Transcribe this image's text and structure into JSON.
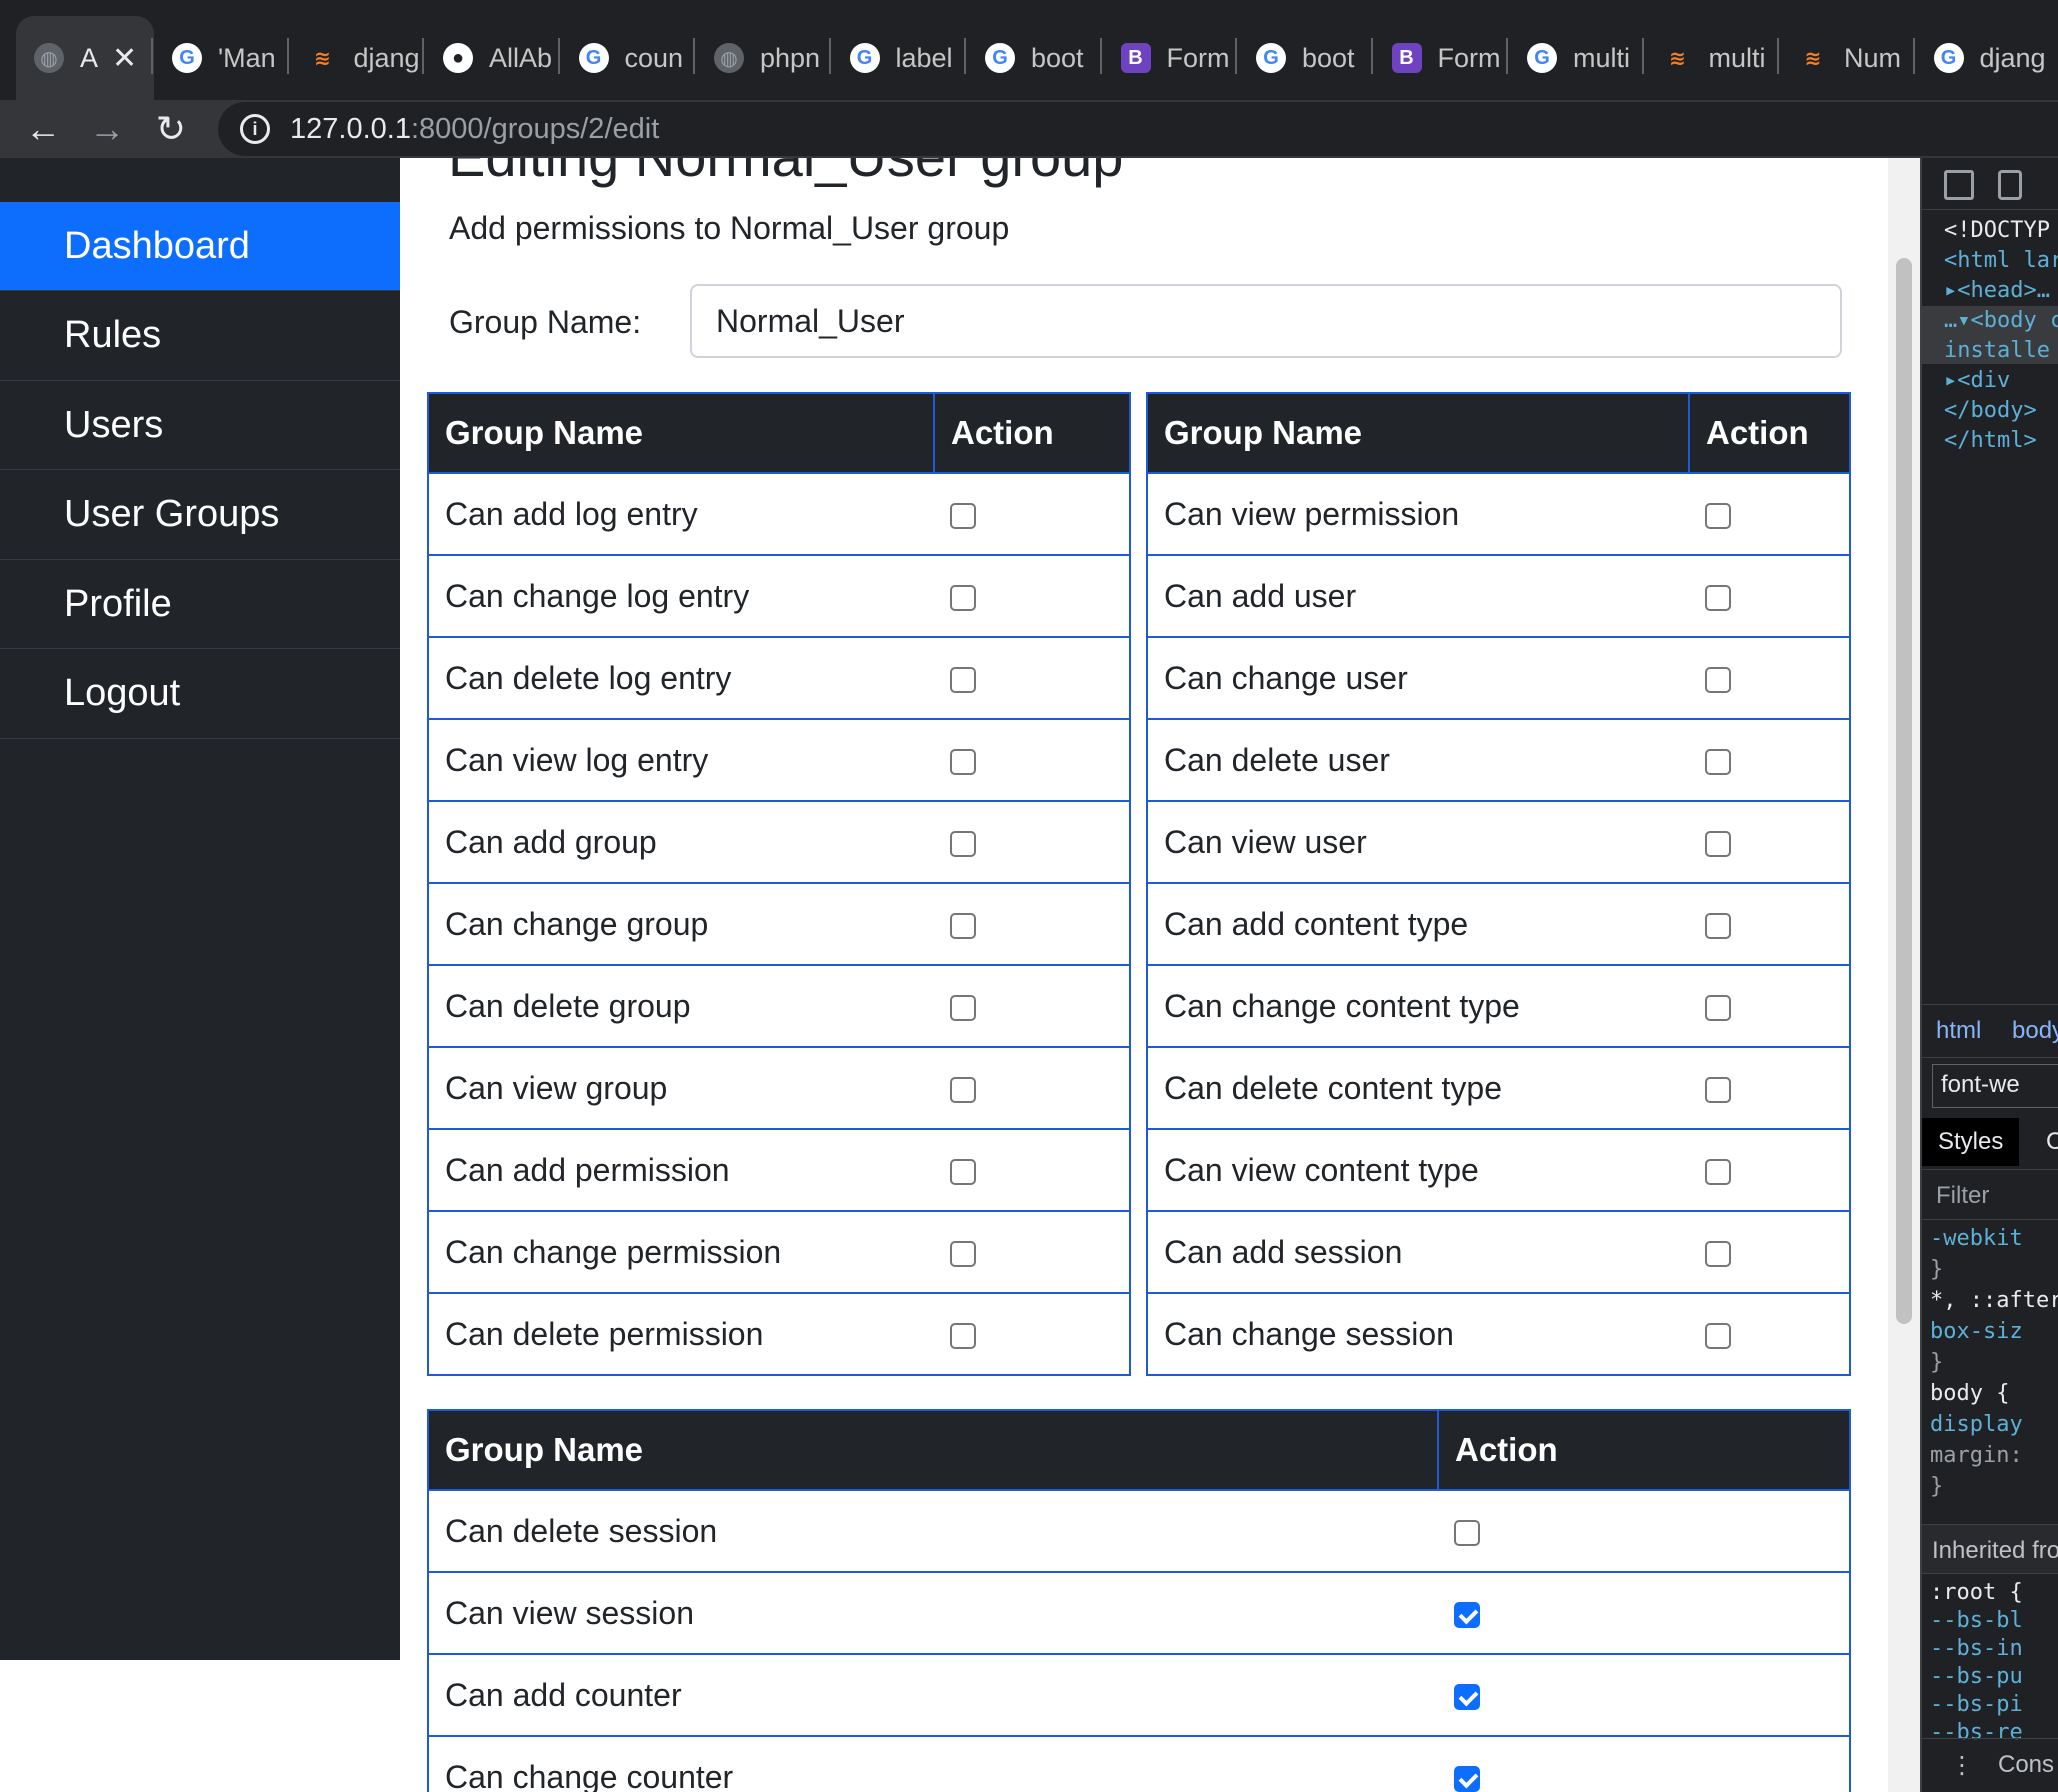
{
  "browser": {
    "tabs": [
      {
        "title": "A",
        "icon": "globe-icon",
        "active": true
      },
      {
        "title": "'Man",
        "icon": "google-icon"
      },
      {
        "title": "djang",
        "icon": "stackoverflow-icon"
      },
      {
        "title": "AllAb",
        "icon": "github-icon"
      },
      {
        "title": "coun",
        "icon": "google-icon"
      },
      {
        "title": "phpn",
        "icon": "globe-icon"
      },
      {
        "title": "label",
        "icon": "google-icon"
      },
      {
        "title": "boot",
        "icon": "google-icon"
      },
      {
        "title": "Form",
        "icon": "bootstrap-icon"
      },
      {
        "title": "boot",
        "icon": "google-icon"
      },
      {
        "title": "Form",
        "icon": "bootstrap-icon"
      },
      {
        "title": "multi",
        "icon": "google-icon"
      },
      {
        "title": "multi",
        "icon": "stackoverflow-icon"
      },
      {
        "title": "Num",
        "icon": "stackoverflow-icon"
      },
      {
        "title": "djang",
        "icon": "google-icon"
      }
    ],
    "close_glyph": "✕",
    "url_host": "127.0.0.1",
    "url_path": ":8000/groups/2/edit",
    "back_glyph": "←",
    "forward_glyph": "→",
    "reload_glyph": "↻"
  },
  "sidebar": {
    "items": [
      {
        "label": "Dashboard",
        "active": true
      },
      {
        "label": "Rules"
      },
      {
        "label": "Users"
      },
      {
        "label": "User Groups"
      },
      {
        "label": "Profile"
      },
      {
        "label": "Logout"
      }
    ]
  },
  "main": {
    "title": "Editing Normal_User group",
    "subtitle": "Add permissions to Normal_User group",
    "group_name_label": "Group Name:",
    "group_name_value": "Normal_User",
    "col_name": "Group Name",
    "col_action": "Action",
    "table_left": [
      {
        "label": "Can add log entry",
        "checked": false
      },
      {
        "label": "Can change log entry",
        "checked": false
      },
      {
        "label": "Can delete log entry",
        "checked": false
      },
      {
        "label": "Can view log entry",
        "checked": false
      },
      {
        "label": "Can add group",
        "checked": false
      },
      {
        "label": "Can change group",
        "checked": false
      },
      {
        "label": "Can delete group",
        "checked": false
      },
      {
        "label": "Can view group",
        "checked": false
      },
      {
        "label": "Can add permission",
        "checked": false
      },
      {
        "label": "Can change permission",
        "checked": false
      },
      {
        "label": "Can delete permission",
        "checked": false
      }
    ],
    "table_right": [
      {
        "label": "Can view permission",
        "checked": false
      },
      {
        "label": "Can add user",
        "checked": false
      },
      {
        "label": "Can change user",
        "checked": false
      },
      {
        "label": "Can delete user",
        "checked": false
      },
      {
        "label": "Can view user",
        "checked": false
      },
      {
        "label": "Can add content type",
        "checked": false
      },
      {
        "label": "Can change content type",
        "checked": false
      },
      {
        "label": "Can delete content type",
        "checked": false
      },
      {
        "label": "Can view content type",
        "checked": false
      },
      {
        "label": "Can add session",
        "checked": false
      },
      {
        "label": "Can change session",
        "checked": false
      }
    ],
    "table_bottom": [
      {
        "label": "Can delete session",
        "checked": false
      },
      {
        "label": "Can view session",
        "checked": true
      },
      {
        "label": "Can add counter",
        "checked": true
      },
      {
        "label": "Can change counter",
        "checked": true
      }
    ]
  },
  "devtools": {
    "dom_lines": [
      {
        "text": "<!DOCTYP",
        "cls": "c-txt"
      },
      {
        "text": "<html lar",
        "cls": "c-tag"
      },
      {
        "text": "▸<head>…",
        "cls": "c-tag"
      },
      {
        "text": "…▾<body c",
        "cls": "c-tag"
      },
      {
        "text": " installe",
        "cls": "c-tag"
      },
      {
        "text": "▸<div",
        "cls": "c-tag"
      },
      {
        "text": "</body>",
        "cls": "c-tag"
      },
      {
        "text": "</html>",
        "cls": "c-tag"
      }
    ],
    "crumb_html": "html",
    "crumb_body": "body",
    "filter_input_value": "font-we",
    "tab_styles": "Styles",
    "tab_next": "C",
    "filter_placeholder": "Filter",
    "css_lines": [
      {
        "text": "  -webkit",
        "cls": "c-prop"
      },
      {
        "text": "}",
        "cls": "c-gray"
      },
      {
        "text": "*, ::after",
        "cls": "c-txt"
      },
      {
        "text": "  box-siz",
        "cls": "c-prop"
      },
      {
        "text": "}",
        "cls": "c-gray"
      },
      {
        "text": "body {",
        "cls": "c-txt"
      },
      {
        "text": "  display",
        "cls": "c-prop"
      },
      {
        "text": "  margin:",
        "cls": "c-gray"
      },
      {
        "text": "}",
        "cls": "c-gray"
      }
    ],
    "inherited_label": "Inherited fro",
    "root_lines": [
      {
        "text": ":root {",
        "cls": "c-txt"
      },
      {
        "text": "  --bs-bl",
        "cls": "c-prop"
      },
      {
        "text": "  --bs-in",
        "cls": "c-prop"
      },
      {
        "text": "  --bs-pu",
        "cls": "c-prop"
      },
      {
        "text": "  --bs-pi",
        "cls": "c-prop"
      },
      {
        "text": "  --bs-re",
        "cls": "c-prop"
      }
    ],
    "console_label": "Cons",
    "kebab_glyph": "⋮"
  },
  "colors": {
    "sidebar_bg": "#212529",
    "active_blue": "#0d6efd",
    "table_border": "#1f5bd6"
  }
}
